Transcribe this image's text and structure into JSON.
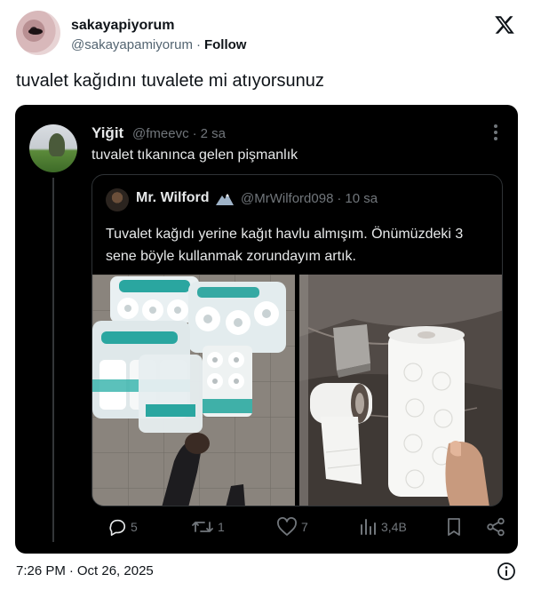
{
  "outer_tweet": {
    "display_name": "sakayapiyorum",
    "handle": "@sakayapamiyorum",
    "separator": "·",
    "follow_label": "Follow",
    "text": "tuvalet kağıdını tuvalete mi atıyorsunuz"
  },
  "inner_tweet": {
    "display_name": "Yiğit",
    "handle": "@fmeevc",
    "separator": "·",
    "time_ago": "2 sa",
    "text": "tuvalet tıkanınca gelen pişmanlık"
  },
  "quoted_tweet": {
    "display_name": "Mr. Wilford",
    "handle": "@MrWilford098",
    "separator": "·",
    "time_ago": "10 sa",
    "text": "Tuvalet kağıdı yerine kağıt havlu almışım. Önümüzdeki 3 sene böyle kullanmak zorundayım artık."
  },
  "actions": {
    "replies": "5",
    "retweets": "1",
    "likes": "7",
    "views": "3,4B"
  },
  "footer": {
    "time": "7:26 PM",
    "separator": "·",
    "date": "Oct 26, 2025"
  },
  "icons": {
    "x_logo": "x-logo-icon",
    "more": "more-options-icon",
    "reply": "reply-icon",
    "retweet": "retweet-icon",
    "like": "heart-icon",
    "views": "views-chart-icon",
    "bookmark": "bookmark-icon",
    "share": "share-icon",
    "info": "info-icon"
  },
  "colors": {
    "card_background": "#000000",
    "secondary_text": "#71767b",
    "primary_text_dark": "#e7e9ea",
    "primary_text_light": "#0f1419"
  }
}
